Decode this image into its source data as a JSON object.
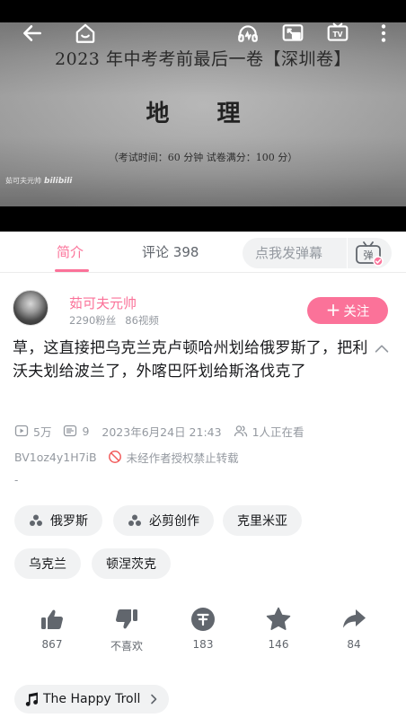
{
  "player": {
    "paper_title": "2023 年中考考前最后一卷【深圳卷】",
    "paper_subject": "地 理",
    "paper_note": "（考试时间：60 分钟   试卷满分：100 分）",
    "watermark_user": "茹可夫元帅",
    "watermark_brand": "bilibili",
    "controls": [
      "back-arrow-icon",
      "home-icon",
      "audio-mode-icon",
      "picture-in-picture-icon",
      "tv-cast-icon",
      "more-vertical-icon"
    ]
  },
  "tabs": {
    "intro": "简介",
    "comments": "评论",
    "comments_count": "398",
    "danmaku_placeholder": "点我发弹幕",
    "danmaku_toggle": "弹"
  },
  "uploader": {
    "name": "茹可夫元帅",
    "fans": "2290粉丝",
    "videos": "86视频",
    "follow_label": "关注",
    "follow_plus": "+"
  },
  "video": {
    "title": "草，这直接把乌克兰克卢顿哈州划给俄罗斯了，把利沃夫划给波兰了，外喀巴阡划给斯洛伐克了",
    "views": "5万",
    "danmaku": "9",
    "date": "2023年6月24日 21:43",
    "watching": "1人正在看",
    "bvid": "BV1oz4y1H7iB",
    "copyright": "未经作者授权禁止转载",
    "desc": "-"
  },
  "tags": [
    {
      "label": "俄罗斯",
      "icon": "channel-dots-icon"
    },
    {
      "label": "必剪创作",
      "icon": "channel-dots-icon"
    },
    {
      "label": "克里米亚",
      "icon": ""
    },
    {
      "label": "乌克兰",
      "icon": ""
    },
    {
      "label": "顿涅茨克",
      "icon": ""
    }
  ],
  "actions": {
    "like": "867",
    "dislike": "不喜欢",
    "coin": "183",
    "favorite": "146",
    "share": "84"
  },
  "bgm": {
    "title": "The Happy Troll"
  },
  "colors": {
    "accent": "#fb7299",
    "text": "#18191c",
    "muted": "#9499a0",
    "chip": "#f1f2f3",
    "icon": "#61666d"
  }
}
